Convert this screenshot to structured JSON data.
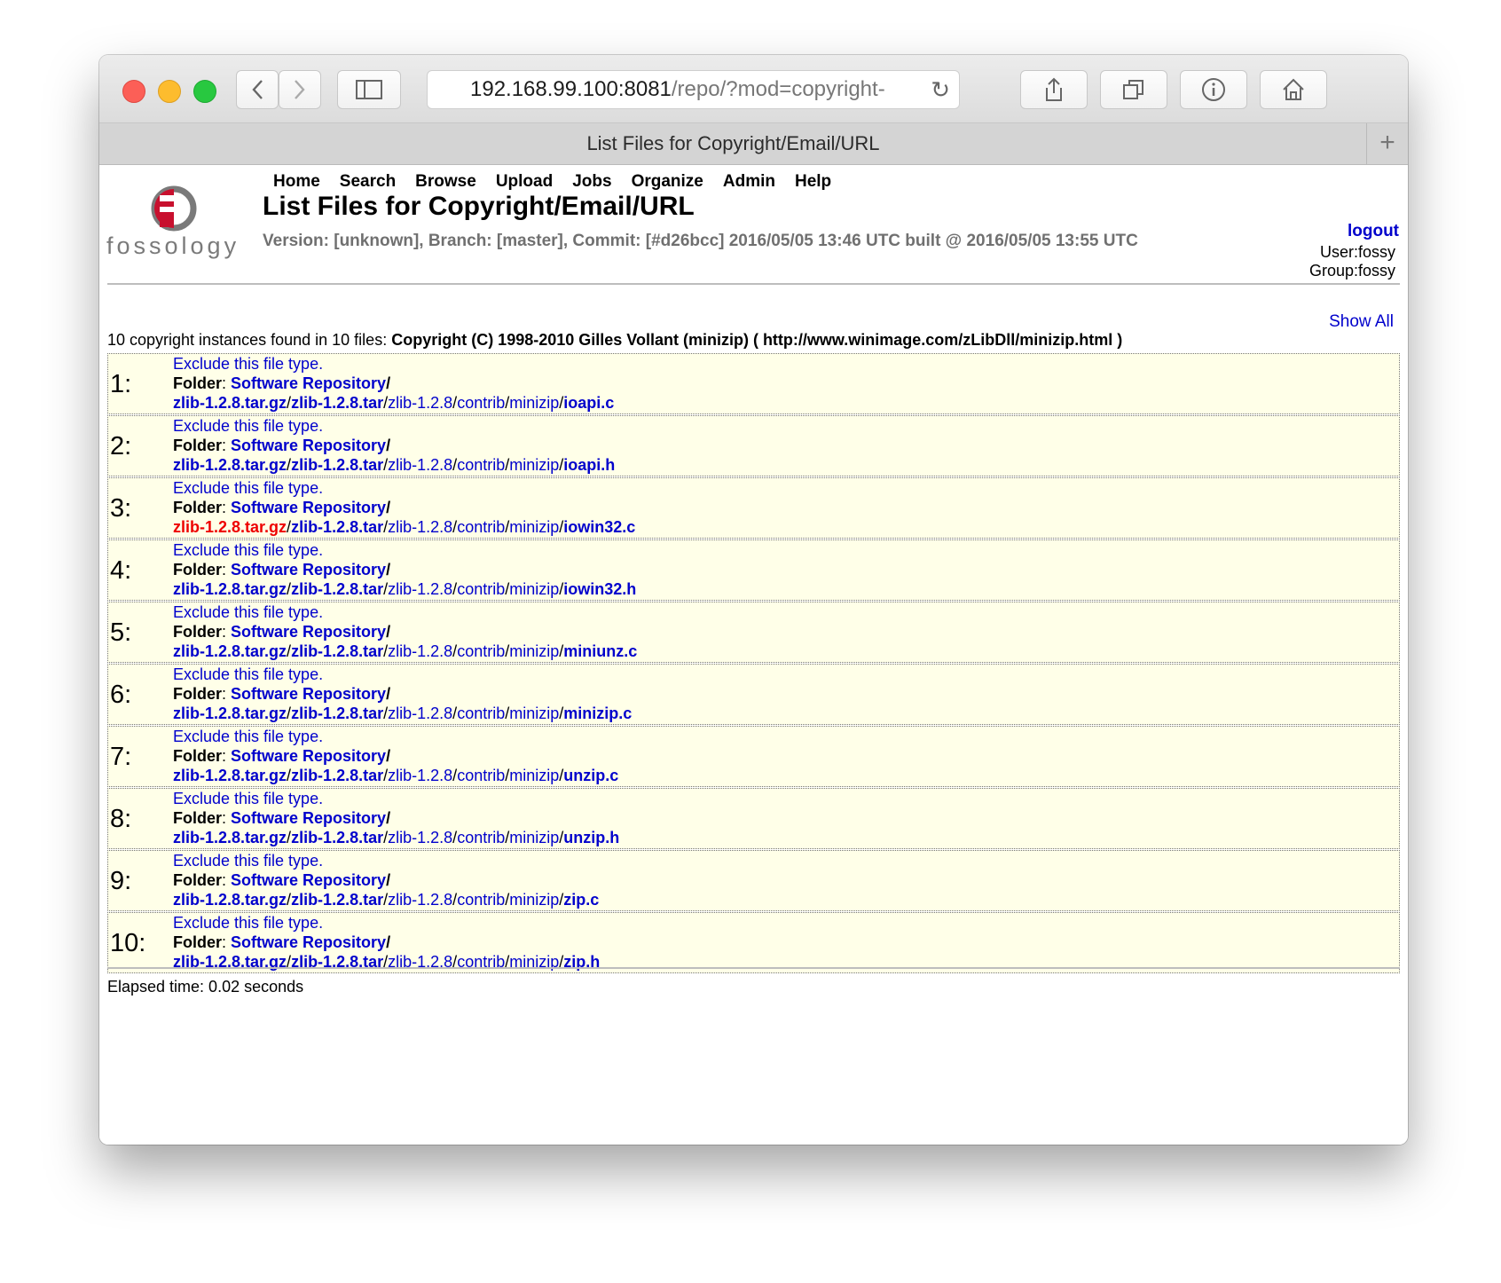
{
  "browser": {
    "url_host": "192.168.99.100:8081",
    "url_rest": "/repo/?mod=copyright-",
    "tab_title": "List Files for Copyright/Email/URL",
    "new_tab_glyph": "+"
  },
  "header": {
    "logo_text": "fossology",
    "nav": [
      "Home",
      "Search",
      "Browse",
      "Upload",
      "Jobs",
      "Organize",
      "Admin",
      "Help"
    ],
    "title": "List Files for Copyright/Email/URL",
    "version": "Version: [unknown], Branch: [master], Commit: [#d26bcc] 2016/05/05 13:46 UTC built @ 2016/05/05 13:55 UTC",
    "logout": "logout",
    "user": "User:fossy",
    "group": "Group:fossy"
  },
  "summary": {
    "show_all": "Show All",
    "prefix": "10 copyright instances found in 10 files: ",
    "statement": "Copyright (C) 1998-2010 Gilles Vollant (minizip) ( http://www.winimage.com/zLibDll/minizip.html )"
  },
  "labels": {
    "exclude": "Exclude this file type.",
    "folder": "Folder",
    "colon": ": ",
    "folder_name": "Software Repository",
    "slash": "/"
  },
  "path": {
    "archive": "zlib-1.2.8.tar.gz",
    "tar": "zlib-1.2.8.tar",
    "dir": "zlib-1.2.8",
    "contrib": "contrib",
    "minizip": "minizip"
  },
  "results": [
    {
      "num": "1:",
      "file": "ioapi.c",
      "highlight": false
    },
    {
      "num": "2:",
      "file": "ioapi.h",
      "highlight": false
    },
    {
      "num": "3:",
      "file": "iowin32.c",
      "highlight": true
    },
    {
      "num": "4:",
      "file": "iowin32.h",
      "highlight": false
    },
    {
      "num": "5:",
      "file": "miniunz.c",
      "highlight": false
    },
    {
      "num": "6:",
      "file": "minizip.c",
      "highlight": false
    },
    {
      "num": "7:",
      "file": "unzip.c",
      "highlight": false
    },
    {
      "num": "8:",
      "file": "unzip.h",
      "highlight": false
    },
    {
      "num": "9:",
      "file": "zip.c",
      "highlight": false
    },
    {
      "num": "10:",
      "file": "zip.h",
      "highlight": false
    }
  ],
  "footer": {
    "elapsed": "Elapsed time: 0.02 seconds"
  },
  "colors": {
    "link": "#0000cc",
    "highlight": "#ee0000",
    "row_bg": "#ffffe8",
    "logo_red": "#c8102e"
  }
}
